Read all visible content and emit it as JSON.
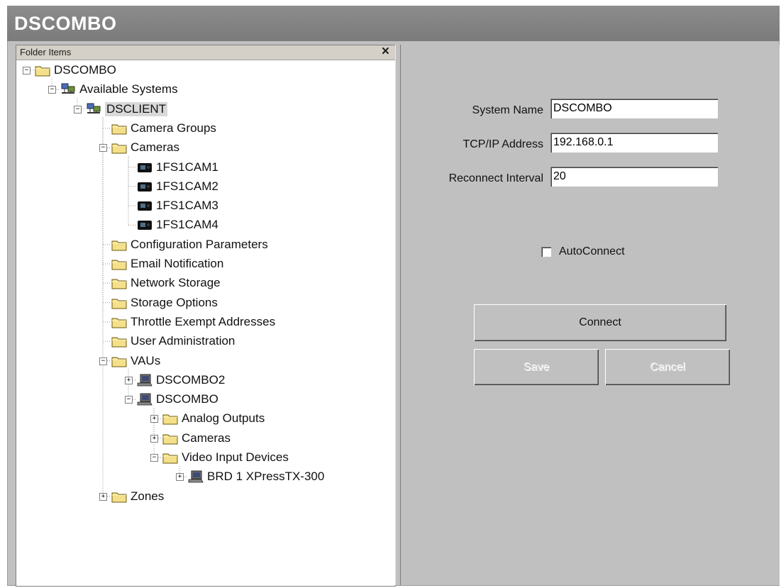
{
  "window": {
    "title": "DSCOMBO"
  },
  "left_pane": {
    "header_label": "Folder Items",
    "close_glyph": "×",
    "tree": [
      {
        "label": "DSCOMBO",
        "icon": "folder-icon",
        "expander": "−"
      },
      {
        "label": "Available Systems",
        "icon": "network-systems-icon",
        "expander": "−"
      },
      {
        "label": "DSCLIENT",
        "icon": "network-systems-icon",
        "expander": "−",
        "selected": true
      },
      {
        "label": "Camera Groups",
        "icon": "folder-icon",
        "expander": ""
      },
      {
        "label": "Cameras",
        "icon": "folder-icon",
        "expander": "−"
      },
      {
        "label": "1FS1CAM1",
        "icon": "camera-icon",
        "expander": ""
      },
      {
        "label": "1FS1CAM2",
        "icon": "camera-icon",
        "expander": ""
      },
      {
        "label": "1FS1CAM3",
        "icon": "camera-icon",
        "expander": ""
      },
      {
        "label": "1FS1CAM4",
        "icon": "camera-icon",
        "expander": ""
      },
      {
        "label": "Configuration Parameters",
        "icon": "folder-icon",
        "expander": ""
      },
      {
        "label": "Email Notification",
        "icon": "folder-icon",
        "expander": ""
      },
      {
        "label": "Network Storage",
        "icon": "folder-icon",
        "expander": ""
      },
      {
        "label": "Storage Options",
        "icon": "folder-icon",
        "expander": ""
      },
      {
        "label": "Throttle Exempt Addresses",
        "icon": "folder-icon",
        "expander": ""
      },
      {
        "label": "User Administration",
        "icon": "folder-icon",
        "expander": ""
      },
      {
        "label": "VAUs",
        "icon": "folder-icon",
        "expander": "−"
      },
      {
        "label": "DSCOMBO2",
        "icon": "computer-icon",
        "expander": "+"
      },
      {
        "label": "DSCOMBO",
        "icon": "computer-icon",
        "expander": "−"
      },
      {
        "label": "Analog Outputs",
        "icon": "folder-icon",
        "expander": "+"
      },
      {
        "label": "Cameras",
        "icon": "folder-icon",
        "expander": "+"
      },
      {
        "label": "Video Input Devices",
        "icon": "folder-icon",
        "expander": "−"
      },
      {
        "label": "BRD 1 XPressTX-300",
        "icon": "computer-icon",
        "expander": "+"
      },
      {
        "label": "Zones",
        "icon": "folder-icon",
        "expander": "+"
      }
    ]
  },
  "form": {
    "system_name_label": "System Name",
    "system_name_value": "DSCOMBO",
    "tcpip_label": "TCP/IP Address",
    "tcpip_value": "192.168.0.1",
    "reconnect_label": "Reconnect Interval",
    "reconnect_value": "20",
    "autoconnect_label": "AutoConnect",
    "autoconnect_checked": false,
    "connect_label": "Connect",
    "save_label": "Save",
    "cancel_label": "Cancel"
  },
  "colors": {
    "title_bar": "#7f7f7f",
    "panel_bg": "#c0c0c0",
    "folder_yellow": "#f5e08a"
  }
}
